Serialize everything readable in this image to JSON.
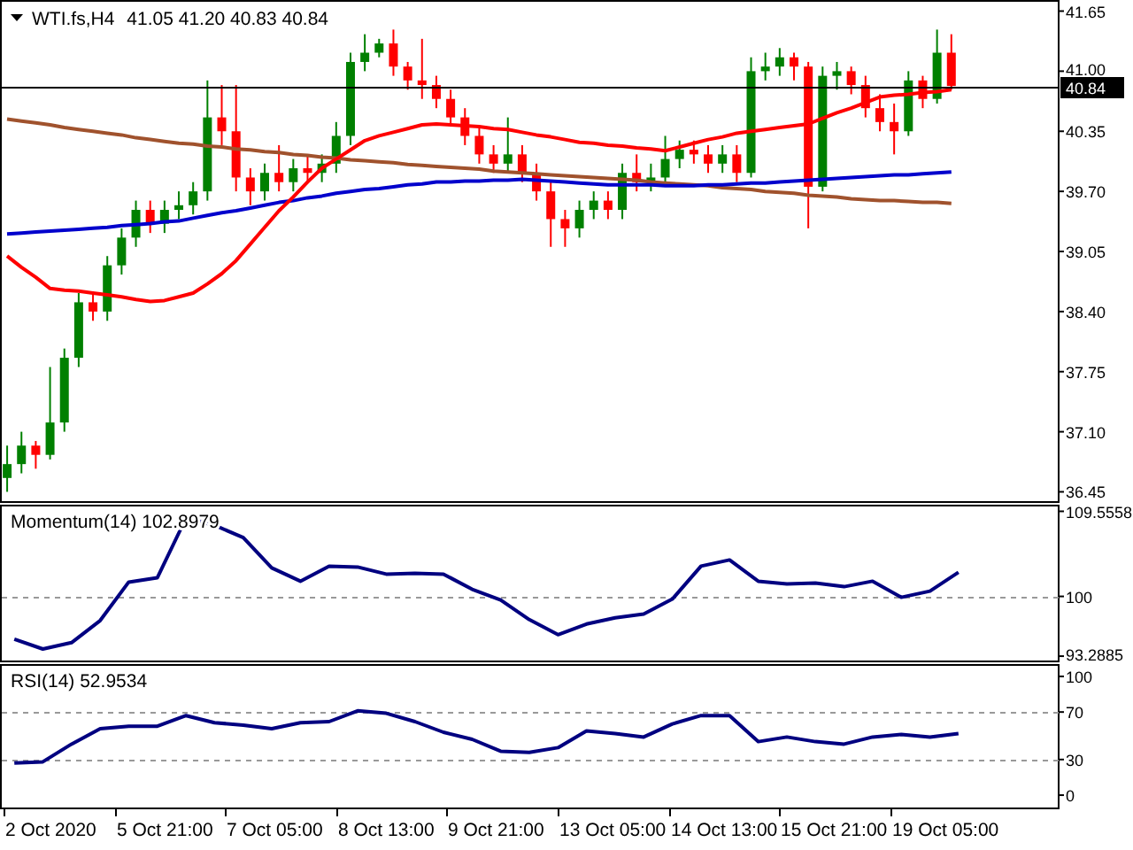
{
  "price_panel": {
    "symbol": "WTI.fs,H4",
    "quote": "41.05 41.20 40.83 40.84",
    "chart_data": {
      "type": "candlestick",
      "ylim": [
        36.33,
        41.77
      ],
      "categories": [
        null,
        null,
        null,
        null,
        null,
        null,
        null,
        null,
        null,
        null,
        null,
        null,
        null,
        null,
        null,
        null,
        null,
        null,
        null,
        null,
        null,
        null,
        null,
        null,
        null,
        null,
        null,
        null,
        null,
        null,
        null,
        null,
        null,
        null,
        null,
        null,
        null,
        null,
        null,
        null,
        null,
        null,
        null,
        null,
        null,
        null,
        null,
        null,
        null,
        null,
        null,
        null,
        null,
        null,
        null,
        null,
        null,
        null,
        null,
        null,
        null,
        null,
        null,
        null,
        null,
        null,
        null,
        null,
        null,
        null,
        null,
        null,
        null,
        null
      ],
      "yticks": [
        {
          "value": 41.65,
          "label": "41.65"
        },
        {
          "value": 41.0,
          "label": "41.00"
        },
        {
          "value": 40.35,
          "label": "40.35"
        },
        {
          "value": 39.7,
          "label": "39.70"
        },
        {
          "value": 39.05,
          "label": "39.05"
        },
        {
          "value": 38.4,
          "label": "38.40"
        },
        {
          "value": 37.75,
          "label": "37.75"
        },
        {
          "value": 37.1,
          "label": "37.10"
        },
        {
          "value": 36.45,
          "label": "36.45"
        }
      ],
      "ohlc": [
        [
          36.6,
          36.95,
          36.45,
          36.75
        ],
        [
          36.75,
          37.1,
          36.65,
          36.95
        ],
        [
          36.95,
          37.0,
          36.7,
          36.85
        ],
        [
          36.85,
          37.8,
          36.8,
          37.2
        ],
        [
          37.2,
          38.0,
          37.1,
          37.9
        ],
        [
          37.9,
          38.6,
          37.8,
          38.5
        ],
        [
          38.5,
          38.6,
          38.3,
          38.4
        ],
        [
          38.4,
          39.0,
          38.3,
          38.9
        ],
        [
          38.9,
          39.3,
          38.8,
          39.2
        ],
        [
          39.2,
          39.6,
          39.1,
          39.5
        ],
        [
          39.5,
          39.6,
          39.25,
          39.35
        ],
        [
          39.35,
          39.6,
          39.25,
          39.5
        ],
        [
          39.5,
          39.7,
          39.4,
          39.55
        ],
        [
          39.55,
          39.8,
          39.45,
          39.7
        ],
        [
          39.7,
          40.9,
          39.6,
          40.5
        ],
        [
          40.5,
          40.85,
          40.2,
          40.35
        ],
        [
          40.35,
          40.85,
          39.7,
          39.85
        ],
        [
          39.85,
          39.95,
          39.55,
          39.7
        ],
        [
          39.7,
          40.0,
          39.6,
          39.9
        ],
        [
          39.9,
          40.2,
          39.7,
          39.8
        ],
        [
          39.8,
          40.05,
          39.7,
          39.95
        ],
        [
          39.95,
          40.1,
          39.8,
          39.9
        ],
        [
          39.9,
          40.1,
          39.8,
          40.0
        ],
        [
          40.0,
          40.45,
          39.9,
          40.3
        ],
        [
          40.3,
          41.2,
          40.2,
          41.1
        ],
        [
          41.1,
          41.4,
          41.0,
          41.2
        ],
        [
          41.2,
          41.35,
          41.15,
          41.3
        ],
        [
          41.3,
          41.45,
          40.95,
          41.05
        ],
        [
          41.05,
          41.1,
          40.8,
          40.9
        ],
        [
          40.9,
          41.35,
          40.7,
          40.85
        ],
        [
          40.85,
          40.95,
          40.6,
          40.7
        ],
        [
          40.7,
          40.8,
          40.4,
          40.5
        ],
        [
          40.5,
          40.6,
          40.2,
          40.3
        ],
        [
          40.3,
          40.4,
          40.0,
          40.1
        ],
        [
          40.1,
          40.2,
          39.9,
          40.0
        ],
        [
          40.0,
          40.5,
          39.9,
          40.1
        ],
        [
          40.1,
          40.2,
          39.8,
          39.9
        ],
        [
          39.9,
          40.0,
          39.6,
          39.7
        ],
        [
          39.7,
          39.8,
          39.1,
          39.4
        ],
        [
          39.4,
          39.5,
          39.1,
          39.3
        ],
        [
          39.3,
          39.6,
          39.2,
          39.5
        ],
        [
          39.5,
          39.7,
          39.4,
          39.6
        ],
        [
          39.6,
          39.7,
          39.4,
          39.5
        ],
        [
          39.5,
          40.0,
          39.4,
          39.9
        ],
        [
          39.9,
          40.1,
          39.7,
          39.8
        ],
        [
          39.8,
          40.0,
          39.7,
          39.85
        ],
        [
          39.85,
          40.3,
          39.75,
          40.05
        ],
        [
          40.05,
          40.25,
          39.95,
          40.15
        ],
        [
          40.15,
          40.25,
          40.0,
          40.1
        ],
        [
          40.1,
          40.2,
          39.9,
          40.0
        ],
        [
          40.0,
          40.2,
          39.9,
          40.1
        ],
        [
          40.1,
          40.2,
          39.8,
          39.9
        ],
        [
          39.9,
          41.15,
          39.85,
          41.0
        ],
        [
          41.0,
          41.2,
          40.9,
          41.05
        ],
        [
          41.05,
          41.25,
          40.95,
          41.15
        ],
        [
          41.15,
          41.2,
          40.9,
          41.05
        ],
        [
          41.05,
          41.1,
          39.3,
          39.75
        ],
        [
          39.75,
          41.05,
          39.7,
          40.95
        ],
        [
          40.95,
          41.1,
          40.8,
          41.0
        ],
        [
          41.0,
          41.05,
          40.75,
          40.85
        ],
        [
          40.85,
          40.95,
          40.5,
          40.6
        ],
        [
          40.6,
          40.75,
          40.35,
          40.45
        ],
        [
          40.45,
          40.65,
          40.1,
          40.35
        ],
        [
          40.35,
          41.0,
          40.3,
          40.9
        ],
        [
          40.9,
          40.95,
          40.6,
          40.7
        ],
        [
          40.7,
          41.45,
          40.65,
          41.2
        ],
        [
          41.2,
          41.4,
          40.8,
          40.84
        ],
        null,
        null,
        null,
        null,
        null,
        null,
        null
      ],
      "series": [
        {
          "type": "line",
          "color": "#a0522d",
          "values": [
            40.48,
            40.46,
            40.44,
            40.42,
            40.39,
            40.37,
            40.35,
            40.33,
            40.31,
            40.28,
            40.26,
            40.24,
            40.22,
            40.21,
            40.19,
            40.18,
            40.16,
            40.15,
            40.13,
            40.12,
            40.1,
            40.09,
            40.07,
            40.06,
            40.04,
            40.03,
            40.02,
            40.01,
            39.99,
            39.98,
            39.97,
            39.96,
            39.95,
            39.94,
            39.92,
            39.91,
            39.9,
            39.89,
            39.88,
            39.87,
            39.86,
            39.85,
            39.84,
            39.83,
            39.82,
            39.8,
            39.79,
            39.78,
            39.77,
            39.76,
            39.74,
            39.73,
            39.72,
            39.7,
            39.69,
            39.68,
            39.66,
            39.65,
            39.64,
            39.62,
            39.61,
            39.6,
            39.6,
            39.59,
            39.58,
            39.58,
            39.57,
            null,
            null,
            null,
            null,
            null,
            null,
            null
          ]
        },
        {
          "type": "line",
          "color": "#0000cc",
          "values": [
            39.24,
            39.25,
            39.26,
            39.27,
            39.28,
            39.29,
            39.3,
            39.31,
            39.33,
            39.34,
            39.35,
            39.37,
            39.38,
            39.41,
            39.44,
            39.47,
            39.49,
            39.52,
            39.55,
            39.58,
            39.6,
            39.63,
            39.65,
            39.68,
            39.7,
            39.72,
            39.73,
            39.75,
            39.77,
            39.78,
            39.8,
            39.8,
            39.81,
            39.81,
            39.82,
            39.82,
            39.83,
            39.82,
            39.81,
            39.8,
            39.79,
            39.78,
            39.77,
            39.77,
            39.77,
            39.77,
            39.76,
            39.76,
            39.76,
            39.77,
            39.77,
            39.78,
            39.79,
            39.79,
            39.8,
            39.81,
            39.82,
            39.83,
            39.84,
            39.85,
            39.86,
            39.87,
            39.88,
            39.88,
            39.89,
            39.9,
            39.91,
            null,
            null,
            null,
            null,
            null,
            null,
            null
          ]
        },
        {
          "type": "line",
          "color": "#ff0000",
          "values": [
            39.0,
            38.88,
            38.77,
            38.65,
            38.63,
            38.62,
            38.6,
            38.58,
            38.56,
            38.53,
            38.51,
            38.52,
            38.56,
            38.6,
            38.7,
            38.81,
            38.95,
            39.13,
            39.31,
            39.49,
            39.64,
            39.8,
            39.95,
            40.05,
            40.15,
            40.25,
            40.3,
            40.34,
            40.38,
            40.42,
            40.43,
            40.42,
            40.41,
            40.4,
            40.38,
            40.37,
            40.34,
            40.31,
            40.29,
            40.26,
            40.23,
            40.22,
            40.2,
            40.19,
            40.17,
            40.16,
            40.14,
            40.18,
            40.22,
            40.26,
            40.29,
            40.33,
            40.35,
            40.37,
            40.39,
            40.41,
            40.43,
            40.49,
            40.55,
            40.6,
            40.66,
            40.72,
            40.74,
            40.75,
            40.77,
            40.78,
            40.8,
            null,
            null,
            null,
            null,
            null,
            null,
            null
          ]
        }
      ],
      "ref_lines": [
        {
          "axis": "y",
          "value": 40.84,
          "label": "40.84"
        }
      ]
    }
  },
  "momentum_panel": {
    "chart_data": {
      "type": "line",
      "title": "Momentum(14) 102.8979",
      "ylim": [
        92.6,
        110.3
      ],
      "categories": [
        null,
        null,
        null,
        null,
        null,
        null,
        null,
        null,
        null,
        null,
        null,
        null,
        null,
        null,
        null,
        null,
        null,
        null,
        null,
        null,
        null,
        null,
        null,
        null,
        null,
        null,
        null,
        null,
        null,
        null,
        null,
        null,
        null,
        null,
        null,
        null,
        null
      ],
      "yticks": [
        {
          "value": 109.5558,
          "label": "109.5558"
        },
        {
          "value": 100,
          "label": "100"
        },
        {
          "value": 93.2885,
          "label": "93.2885"
        }
      ],
      "series": [
        {
          "color": "#000080",
          "values": [
            95.2,
            94.1,
            94.8,
            97.3,
            101.6,
            102.1,
            108.8,
            108.0,
            106.6,
            103.2,
            101.7,
            103.4,
            103.3,
            102.5,
            102.6,
            102.5,
            100.8,
            99.6,
            97.4,
            95.7,
            96.9,
            97.6,
            98.0,
            99.7,
            103.4,
            104.1,
            101.7,
            101.4,
            101.5,
            101.1,
            101.7,
            99.9,
            100.6,
            102.7,
            null,
            null,
            null
          ]
        }
      ]
    }
  },
  "rsi_panel": {
    "chart_data": {
      "type": "line",
      "title": "RSI(14) 52.9534",
      "ylim": [
        -11.9,
        110.4
      ],
      "categories": [
        null,
        null,
        null,
        null,
        null,
        null,
        null,
        null,
        null,
        null,
        null,
        null,
        null,
        null,
        null,
        null,
        null,
        null,
        null,
        null,
        null,
        null,
        null,
        null,
        null,
        null,
        null,
        null,
        null,
        null,
        null,
        null,
        null,
        null,
        null,
        null,
        null
      ],
      "yticks": [
        {
          "value": 100,
          "label": "100"
        },
        {
          "value": 70,
          "label": "70"
        },
        {
          "value": 30,
          "label": "30"
        },
        {
          "value": 0,
          "label": "0"
        }
      ],
      "series": [
        {
          "color": "#000080",
          "values": [
            27,
            28,
            43,
            56,
            58,
            58,
            67,
            61,
            59,
            56,
            61,
            62,
            71,
            69,
            62,
            53,
            47,
            37,
            36,
            40,
            54,
            52,
            49,
            60,
            67,
            67,
            45,
            49,
            45,
            43,
            49,
            51,
            49,
            52,
            null,
            null,
            null
          ]
        }
      ]
    }
  },
  "time_axis": {
    "labels": [
      "2 Oct 2020",
      "5 Oct 21:00",
      "7 Oct 05:00",
      "8 Oct 13:00",
      "9 Oct 21:00",
      "13 Oct 05:00",
      "14 Oct 13:00",
      "15 Oct 21:00",
      "19 Oct 05:00"
    ]
  }
}
